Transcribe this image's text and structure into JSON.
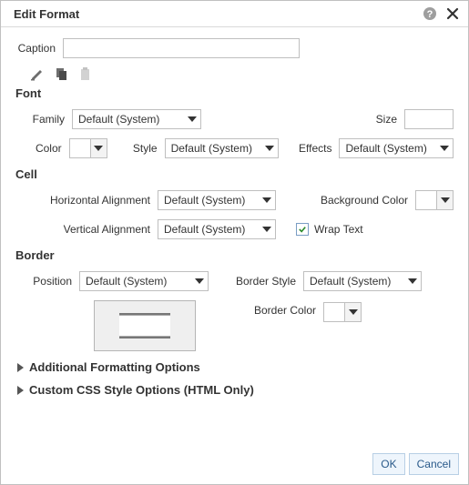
{
  "dialog": {
    "title": "Edit Format"
  },
  "caption": {
    "label": "Caption",
    "value": ""
  },
  "sections": {
    "font": "Font",
    "cell": "Cell",
    "border": "Border"
  },
  "font": {
    "family_label": "Family",
    "family_value": "Default (System)",
    "size_label": "Size",
    "size_value": "",
    "color_label": "Color",
    "style_label": "Style",
    "style_value": "Default (System)",
    "effects_label": "Effects",
    "effects_value": "Default (System)"
  },
  "cell": {
    "halign_label": "Horizontal Alignment",
    "halign_value": "Default (System)",
    "bgcolor_label": "Background Color",
    "valign_label": "Vertical Alignment",
    "valign_value": "Default (System)",
    "wrap_label": "Wrap Text",
    "wrap_checked": true
  },
  "border": {
    "position_label": "Position",
    "position_value": "Default (System)",
    "style_label": "Border Style",
    "style_value": "Default (System)",
    "color_label": "Border Color"
  },
  "expanders": {
    "additional": "Additional Formatting Options",
    "css": "Custom CSS Style Options (HTML Only)"
  },
  "buttons": {
    "ok": "OK",
    "cancel": "Cancel"
  }
}
